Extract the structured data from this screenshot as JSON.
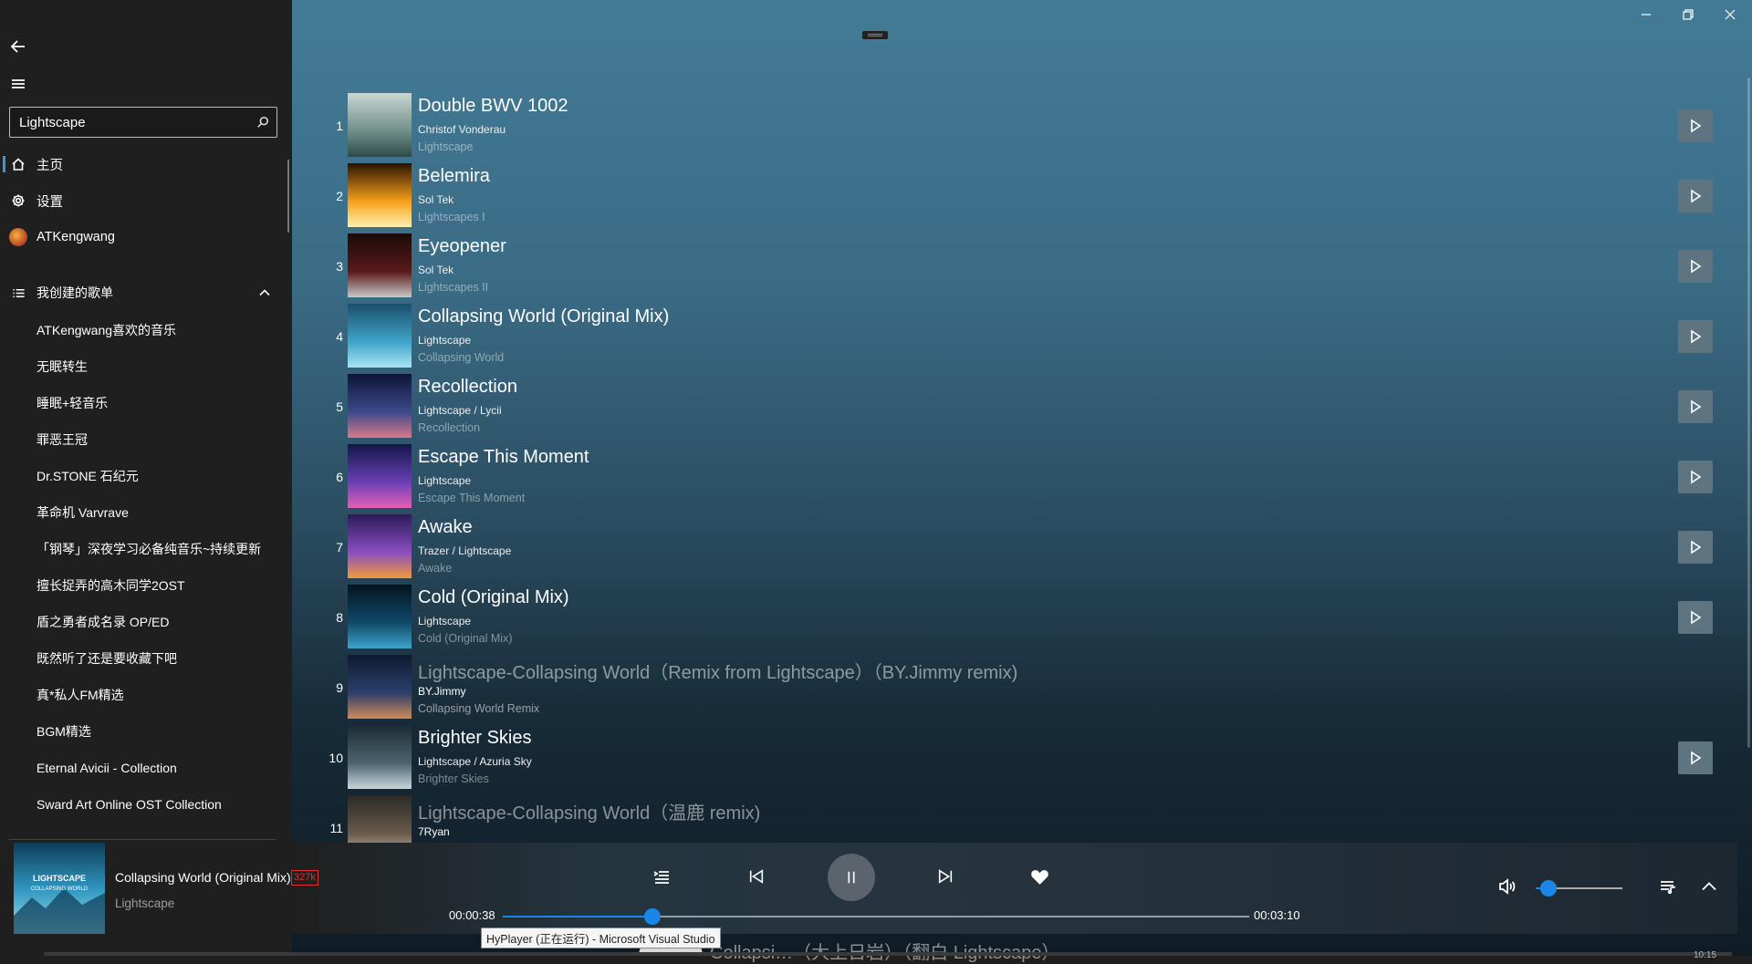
{
  "sidebar": {
    "search_value": "Lightscape",
    "nav": [
      {
        "label": "主页",
        "icon": "home-icon"
      },
      {
        "label": "设置",
        "icon": "gear-icon"
      },
      {
        "label": "ATKengwang",
        "icon": "avatar"
      }
    ],
    "playlists_header": "我创建的歌单",
    "playlists": [
      "ATKengwang喜欢的音乐",
      "无眠转生",
      "睡眠+轻音乐",
      "罪恶王冠",
      "Dr.STONE 石纪元",
      "革命机 Varvrave",
      "「钢琴」深夜学习必备纯音乐~持续更新",
      "擅长捉弄的高木同学2OST",
      "盾之勇者成名录 OP/ED",
      "既然听了还是要收藏下吧",
      "真*私人FM精选",
      "BGM精选",
      "Eternal Avicii - Collection",
      "Sward Art Online OST Collection"
    ]
  },
  "songs": [
    {
      "index": "1",
      "title": "Double BWV 1002",
      "artist": "Christof Vonderau",
      "album": "Lightscape",
      "playable": true,
      "art": [
        "#c9d6d2",
        "#6f8f8a",
        "#2f4a46"
      ]
    },
    {
      "index": "2",
      "title": "Belemira",
      "artist": "Sol Tek",
      "album": "Lightscapes I",
      "playable": true,
      "art": [
        "#2a1200",
        "#f7a01a",
        "#fff2b0"
      ]
    },
    {
      "index": "3",
      "title": "Eyeopener",
      "artist": "Sol Tek",
      "album": "Lightscapes II",
      "playable": true,
      "art": [
        "#1a0a0a",
        "#5a1a1a",
        "#c9c9c9"
      ]
    },
    {
      "index": "4",
      "title": "Collapsing World (Original Mix)",
      "artist": "Lightscape",
      "album": "Collapsing World",
      "playable": true,
      "art": [
        "#1b4f6b",
        "#3fa4c9",
        "#a9e6f2"
      ]
    },
    {
      "index": "5",
      "title": "Recollection",
      "artist": "Lightscape / Lycii",
      "album": "Recollection",
      "playable": true,
      "art": [
        "#0d1436",
        "#3e4a8c",
        "#d77a8a"
      ]
    },
    {
      "index": "6",
      "title": "Escape This Moment",
      "artist": "Lightscape",
      "album": "Escape This Moment",
      "playable": true,
      "art": [
        "#13174a",
        "#6b3fb5",
        "#e35fb6"
      ]
    },
    {
      "index": "7",
      "title": "Awake",
      "artist": "Trazer / Lightscape",
      "album": "Awake",
      "playable": true,
      "art": [
        "#2b1a5a",
        "#8b4fc0",
        "#f29a3a"
      ]
    },
    {
      "index": "8",
      "title": "Cold (Original Mix)",
      "artist": "Lightscape",
      "album": "Cold (Original Mix)",
      "playable": true,
      "art": [
        "#03141f",
        "#0f4a6a",
        "#3fa5c9"
      ]
    },
    {
      "index": "9",
      "title": "Lightscape-Collapsing World（Remix from Lightscape）（BY.Jimmy remix)",
      "artist": "BY.Jimmy",
      "album": "Collapsing World Remix",
      "playable": false,
      "art": [
        "#0d1a30",
        "#2d3f6a",
        "#d08a5a"
      ]
    },
    {
      "index": "10",
      "title": "Brighter Skies",
      "artist": "Lightscape / Azuria Sky",
      "album": "Brighter Skies",
      "playable": true,
      "art": [
        "#1c2a33",
        "#4d6470",
        "#c9d6dc"
      ]
    },
    {
      "index": "11",
      "title": "Lightscape-Collapsing World（温鹿 remix)",
      "artist": "7Ryan",
      "album": "",
      "playable": false,
      "art": [
        "#2a2a2a",
        "#6a5a4a",
        "#c9c0b0"
      ]
    }
  ],
  "player": {
    "title": "Collapsing World (Original Mix)",
    "quality": "327k",
    "artist": "Lightscape",
    "time_current": "00:00:38",
    "time_total": "00:03:10",
    "progress": 0.2,
    "volume": 0.15
  },
  "tooltip": "HyPlayer (正在运行) - Microsoft Visual Studio",
  "peek_text": "Collapsi…（大上日岩）（翻白 Lightscape）",
  "taskbar_time": "10:15",
  "colors": {
    "accent": "#1a87e6",
    "quality": "#e03030"
  }
}
